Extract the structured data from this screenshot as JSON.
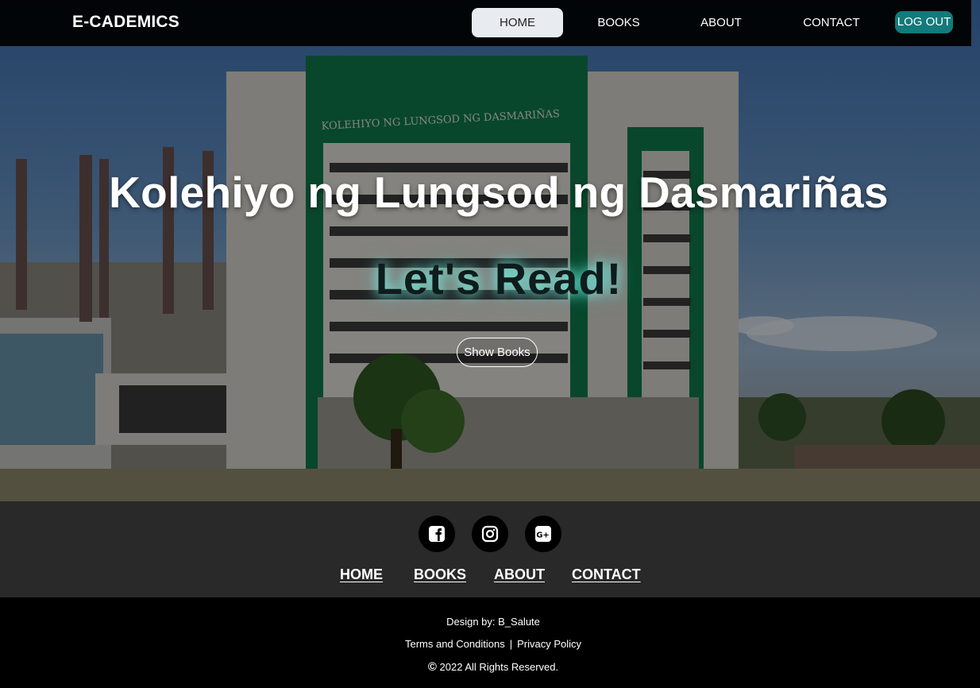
{
  "navbar": {
    "brand": "E-CADEMICS",
    "links": [
      "HOME",
      "BOOKS",
      "ABOUT",
      "CONTACT"
    ],
    "active": "HOME",
    "logout_label": "LOG OUT",
    "accent_color": "#127a7a"
  },
  "hero": {
    "title": "Kolehiyo ng Lungsod ng Dasmariñas",
    "subtitle": "Let's Read!",
    "cta_label": "Show Books",
    "building_sign": "KOLEHIYO NG LUNGSOD NG DASMARIÑAS"
  },
  "footer": {
    "social_icons": [
      "facebook-icon",
      "instagram-icon",
      "google-plus-icon"
    ],
    "links": [
      "HOME",
      "BOOKS",
      "ABOUT",
      "CONTACT"
    ],
    "credit": "Design by: B_Salute",
    "terms": "Terms and Conditions",
    "separator": "|",
    "privacy": "Privacy Policy",
    "copyright_symbol": "©",
    "copyright": "2022 All Rights Reserved."
  }
}
